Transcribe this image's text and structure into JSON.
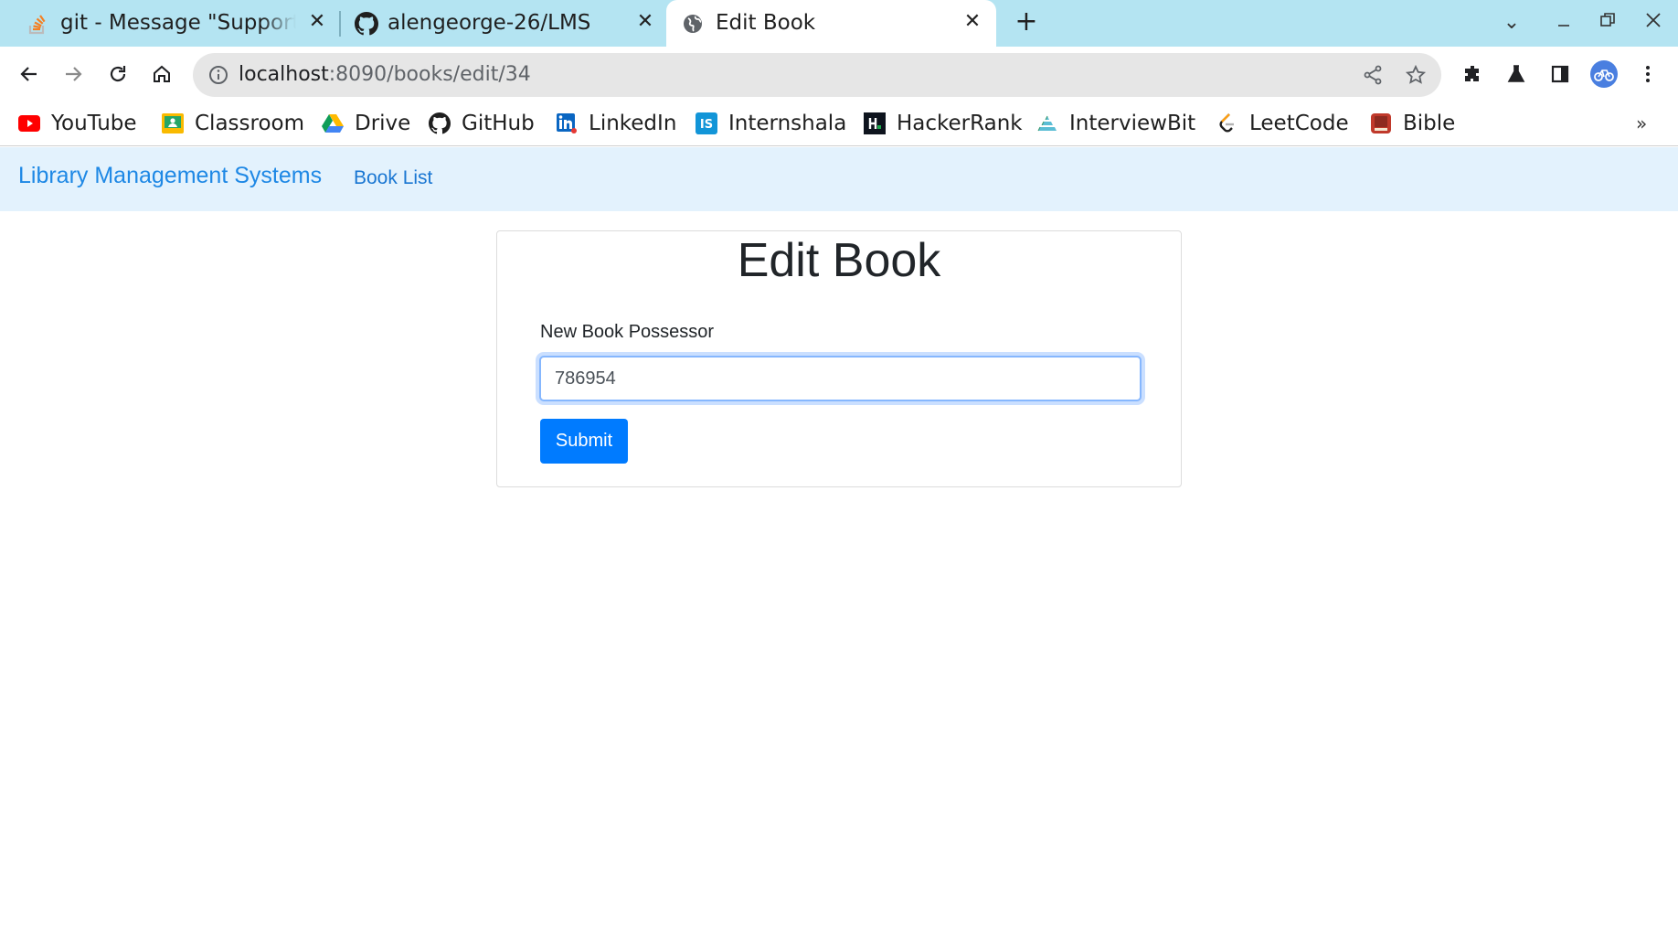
{
  "browser": {
    "tabs": [
      {
        "title": "git - Message \"Support f",
        "favicon": "stackoverflow-icon",
        "active": false
      },
      {
        "title": "alengeorge-26/LMS",
        "favicon": "github-icon",
        "active": false
      },
      {
        "title": "Edit Book",
        "favicon": "globe-icon",
        "active": true
      }
    ],
    "url_host": "localhost",
    "url_path": ":8090/books/edit/34",
    "bookmarks": [
      {
        "label": "YouTube",
        "icon": "youtube-icon"
      },
      {
        "label": "Classroom",
        "icon": "classroom-icon"
      },
      {
        "label": "Drive",
        "icon": "drive-icon"
      },
      {
        "label": "GitHub",
        "icon": "github-icon"
      },
      {
        "label": "LinkedIn",
        "icon": "linkedin-icon"
      },
      {
        "label": "Internshala",
        "icon": "internshala-icon"
      },
      {
        "label": "HackerRank",
        "icon": "hackerrank-icon"
      },
      {
        "label": "InterviewBit",
        "icon": "interviewbit-icon"
      },
      {
        "label": "LeetCode",
        "icon": "leetcode-icon"
      },
      {
        "label": "Bible",
        "icon": "bible-icon"
      }
    ],
    "more_bookmarks": "»"
  },
  "app": {
    "brand": "Library Management Systems",
    "nav_link": "Book List",
    "page_title": "Edit Book",
    "field_label": "New Book Possessor",
    "field_value": "786954",
    "submit_label": "Submit"
  },
  "colors": {
    "tabstrip": "#b4e4f2",
    "navbar": "#e3f2fd",
    "brand": "#1e88e5",
    "button": "#007bff"
  }
}
